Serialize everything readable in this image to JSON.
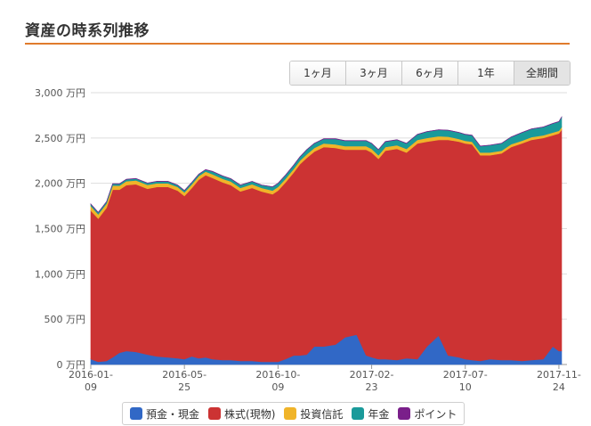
{
  "page": {
    "title": "資産の時系列推移"
  },
  "range_selector": {
    "buttons": [
      {
        "label": "1ヶ月",
        "active": false
      },
      {
        "label": "3ヶ月",
        "active": false
      },
      {
        "label": "6ヶ月",
        "active": false
      },
      {
        "label": "1年",
        "active": false
      },
      {
        "label": "全期間",
        "active": true
      }
    ]
  },
  "colors": {
    "accent_rule": "#e07b2c",
    "gridline": "#dddddd"
  },
  "chart_data": {
    "type": "area",
    "stacked": true,
    "title": "",
    "xlabel": "",
    "ylabel": "",
    "ylim": [
      0,
      3000
    ],
    "y_unit": "万円",
    "yticks": [
      "0 万円",
      "500 万円",
      "1,000 万円",
      "1,500 万円",
      "2,000 万円",
      "2,500 万円",
      "3,000 万円"
    ],
    "ytick_values": [
      0,
      500,
      1000,
      1500,
      2000,
      2500,
      3000
    ],
    "xlim": [
      "2016-01-09",
      "2017-11-28"
    ],
    "xticks": [
      {
        "date": "2016-01-09",
        "line1": "2016-01-",
        "line2": "09"
      },
      {
        "date": "2016-05-25",
        "line1": "2016-05-",
        "line2": "25"
      },
      {
        "date": "2016-10-09",
        "line1": "2016-10-",
        "line2": "09"
      },
      {
        "date": "2017-02-23",
        "line1": "2017-02-",
        "line2": "23"
      },
      {
        "date": "2017-07-10",
        "line1": "2017-07-",
        "line2": "10"
      },
      {
        "date": "2017-11-24",
        "line1": "2017-11-",
        "line2": "24"
      }
    ],
    "grid": true,
    "legend_position": "bottom",
    "x": [
      "2016-01-09",
      "2016-01-20",
      "2016-02-01",
      "2016-02-10",
      "2016-02-20",
      "2016-03-01",
      "2016-03-15",
      "2016-04-01",
      "2016-04-15",
      "2016-05-01",
      "2016-05-15",
      "2016-05-25",
      "2016-06-05",
      "2016-06-15",
      "2016-06-25",
      "2016-07-05",
      "2016-07-20",
      "2016-08-01",
      "2016-08-15",
      "2016-09-01",
      "2016-09-15",
      "2016-10-01",
      "2016-10-09",
      "2016-10-20",
      "2016-11-01",
      "2016-11-10",
      "2016-11-20",
      "2016-12-01",
      "2016-12-15",
      "2017-01-01",
      "2017-01-15",
      "2017-02-01",
      "2017-02-15",
      "2017-02-23",
      "2017-03-05",
      "2017-03-15",
      "2017-04-01",
      "2017-04-15",
      "2017-05-01",
      "2017-05-15",
      "2017-06-01",
      "2017-06-15",
      "2017-07-01",
      "2017-07-10",
      "2017-07-20",
      "2017-08-01",
      "2017-08-15",
      "2017-09-01",
      "2017-09-15",
      "2017-10-01",
      "2017-10-15",
      "2017-11-01",
      "2017-11-15",
      "2017-11-24",
      "2017-11-28"
    ],
    "series": [
      {
        "name": "預金・現金",
        "color": "#3168c6",
        "values": [
          60,
          30,
          40,
          80,
          130,
          150,
          140,
          110,
          90,
          80,
          70,
          60,
          90,
          70,
          80,
          60,
          50,
          50,
          40,
          40,
          30,
          30,
          30,
          60,
          100,
          100,
          110,
          200,
          200,
          220,
          300,
          330,
          100,
          80,
          60,
          60,
          50,
          70,
          60,
          200,
          320,
          100,
          80,
          60,
          50,
          40,
          60,
          50,
          50,
          40,
          50,
          60,
          200,
          150,
          150
        ]
      },
      {
        "name": "株式(現物)",
        "color": "#cc3333",
        "values": [
          1640,
          1580,
          1690,
          1850,
          1800,
          1830,
          1850,
          1830,
          1870,
          1880,
          1850,
          1800,
          1860,
          1970,
          2010,
          2000,
          1960,
          1930,
          1870,
          1910,
          1880,
          1850,
          1890,
          1950,
          2020,
          2110,
          2170,
          2150,
          2200,
          2170,
          2070,
          2040,
          2270,
          2260,
          2210,
          2300,
          2330,
          2270,
          2380,
          2260,
          2160,
          2380,
          2380,
          2380,
          2380,
          2270,
          2250,
          2280,
          2350,
          2400,
          2430,
          2440,
          2330,
          2400,
          2440
        ]
      },
      {
        "name": "投資信託",
        "color": "#f0b429",
        "values": [
          50,
          48,
          46,
          45,
          44,
          43,
          42,
          42,
          41,
          40,
          40,
          40,
          40,
          40,
          40,
          40,
          40,
          40,
          40,
          40,
          40,
          40,
          40,
          40,
          40,
          40,
          40,
          40,
          40,
          40,
          40,
          40,
          40,
          40,
          40,
          40,
          40,
          40,
          40,
          40,
          40,
          35,
          30,
          30,
          30,
          30,
          30,
          30,
          30,
          30,
          30,
          30,
          30,
          30,
          30
        ]
      },
      {
        "name": "年金",
        "color": "#1a9a9a",
        "values": [
          20,
          20,
          20,
          20,
          20,
          20,
          20,
          20,
          20,
          20,
          20,
          20,
          20,
          20,
          20,
          30,
          30,
          30,
          30,
          30,
          30,
          40,
          40,
          40,
          40,
          40,
          50,
          50,
          50,
          60,
          60,
          60,
          60,
          60,
          60,
          60,
          60,
          60,
          60,
          70,
          70,
          70,
          70,
          70,
          70,
          70,
          80,
          80,
          80,
          90,
          90,
          90,
          100,
          100,
          110
        ]
      },
      {
        "name": "ポイント",
        "color": "#7a1f8a",
        "values": [
          2,
          2,
          2,
          2,
          2,
          2,
          2,
          2,
          2,
          2,
          2,
          2,
          2,
          2,
          2,
          2,
          2,
          2,
          2,
          2,
          2,
          2,
          2,
          2,
          2,
          2,
          2,
          2,
          2,
          2,
          2,
          2,
          2,
          2,
          2,
          2,
          2,
          2,
          2,
          2,
          2,
          2,
          2,
          2,
          2,
          2,
          2,
          2,
          2,
          2,
          2,
          2,
          2,
          2,
          2
        ]
      }
    ]
  }
}
